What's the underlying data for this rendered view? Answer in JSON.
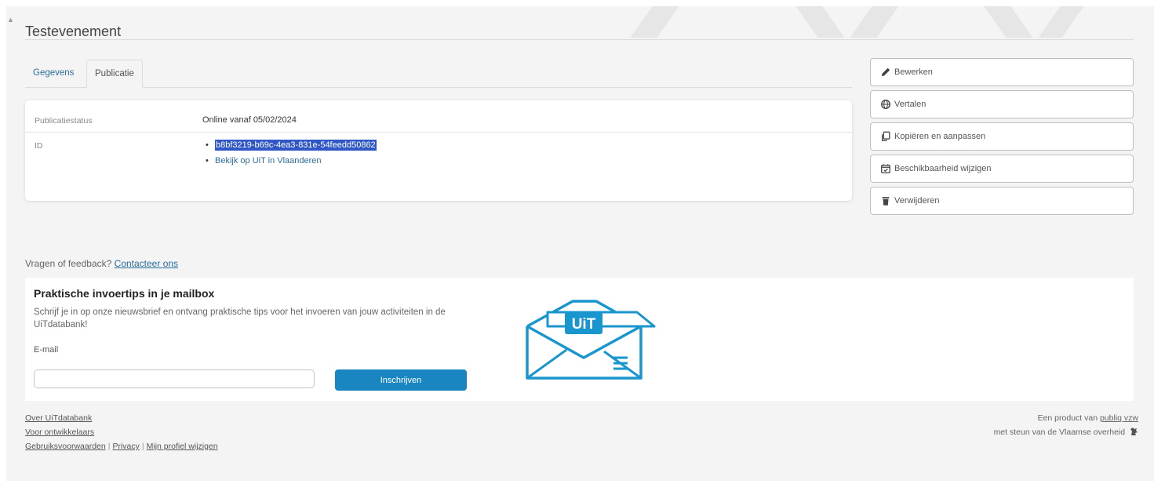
{
  "page": {
    "title": "Testevenement"
  },
  "tabs": [
    {
      "label": "Gegevens",
      "active": false
    },
    {
      "label": "Publicatie",
      "active": true
    }
  ],
  "publication": {
    "status_label": "Publicatiestatus",
    "status_value": "Online vanaf 05/02/2024",
    "id_label": "ID",
    "id_value": "b8bf3219-b69c-4ea3-831e-54feedd50862",
    "view_link": "Bekijk op UiT in Vlaanderen"
  },
  "actions": [
    {
      "label": "Bewerken",
      "icon": "pencil-icon"
    },
    {
      "label": "Vertalen",
      "icon": "globe-icon"
    },
    {
      "label": "Kopiëren en aanpassen",
      "icon": "copy-icon"
    },
    {
      "label": "Beschikbaarheid wijzigen",
      "icon": "calendar-check-icon"
    },
    {
      "label": "Verwijderen",
      "icon": "trash-icon"
    }
  ],
  "feedback": {
    "text": "Vragen of feedback?",
    "link": "Contacteer ons"
  },
  "newsletter": {
    "title": "Praktische invoertips in je mailbox",
    "text": "Schrijf je in op onze nieuwsbrief en ontvang praktische tips voor het invoeren van jouw activiteiten in de UiTdatabank!",
    "email_label": "E-mail",
    "email_value": "",
    "button": "Inschrijven",
    "logo_text": "UiT"
  },
  "footer": {
    "about": "Over UiTdatabank",
    "developers": "Voor ontwikkelaars",
    "terms": "Gebruiksvoorwaarden",
    "separator": "|",
    "privacy": "Privacy",
    "profile": "Mijn profiel wijzigen",
    "product_text": "Een product van",
    "product_link": "publiq vzw",
    "support_text": "met steun van de Vlaamse overheid"
  },
  "colors": {
    "link": "#2b6d9c",
    "primary_button": "#1a86c1",
    "selection": "#2f57c5",
    "illustration": "#1a96cf"
  }
}
